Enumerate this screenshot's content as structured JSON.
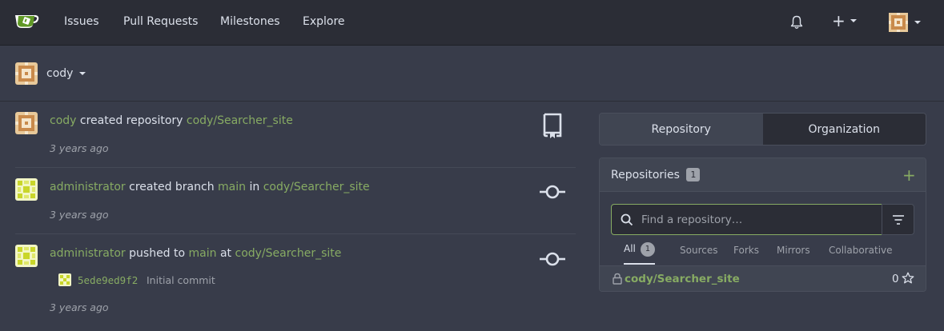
{
  "nav": {
    "links": [
      "Issues",
      "Pull Requests",
      "Milestones",
      "Explore"
    ],
    "plus_label": "+"
  },
  "user": {
    "name": "cody"
  },
  "feed": [
    {
      "actor": "cody",
      "action": "created repository",
      "repo": "cody/Searcher_site",
      "time": "3 years ago",
      "icon": "repo-icon"
    },
    {
      "actor": "administrator",
      "action": "created branch",
      "branch": "main",
      "preposition": "in",
      "repo": "cody/Searcher_site",
      "time": "3 years ago",
      "icon": "commit-icon"
    },
    {
      "actor": "administrator",
      "action": "pushed to",
      "branch": "main",
      "preposition": "at",
      "repo": "cody/Searcher_site",
      "commit_sha": "5ede9ed9f2",
      "commit_message": "Initial commit",
      "time": "3 years ago",
      "icon": "commit-icon"
    }
  ],
  "sidepanel": {
    "tabs": [
      "Repository",
      "Organization"
    ],
    "repos_title": "Repositories",
    "repos_count": "1",
    "search_placeholder": "Find a repository…",
    "subtabs": [
      "All",
      "Sources",
      "Forks",
      "Mirrors",
      "Collaborative"
    ],
    "all_count": "1",
    "repo_list": [
      {
        "name": "cody/Searcher_site",
        "stars": "0"
      }
    ]
  },
  "colors": {
    "accent": "#87ab63",
    "bg": "#383c4a",
    "nav_bg": "#2b2d36"
  }
}
